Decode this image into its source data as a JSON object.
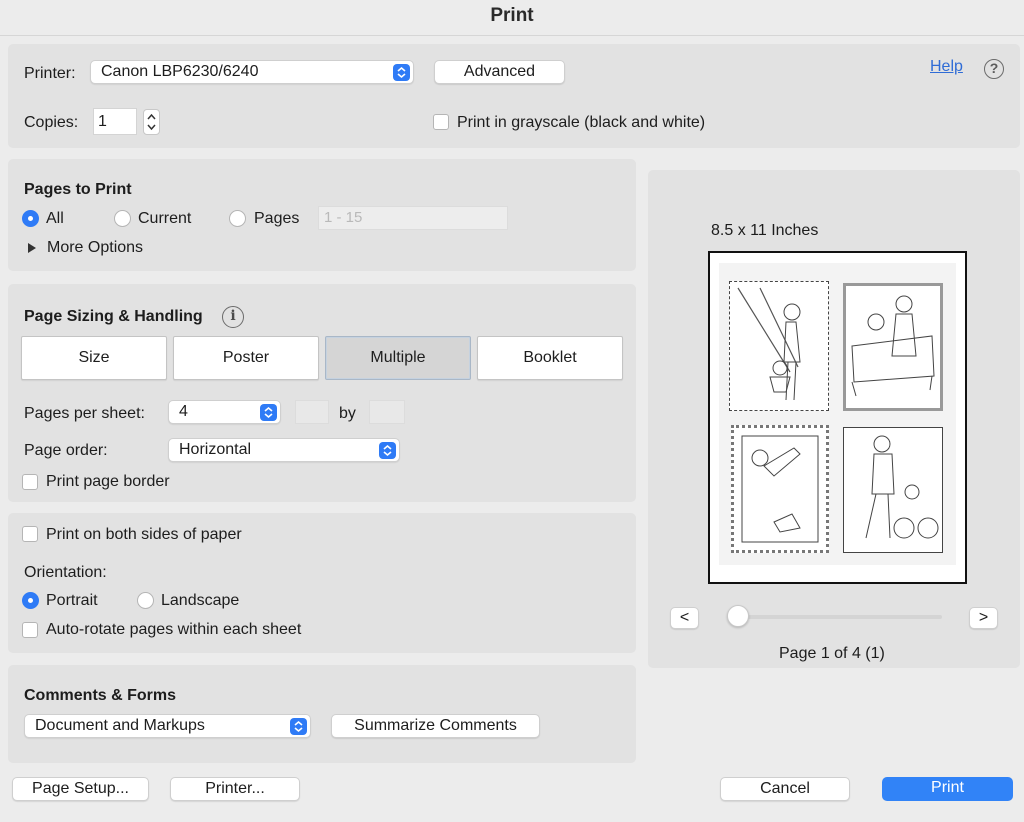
{
  "window": {
    "title": "Print"
  },
  "printer": {
    "label": "Printer:",
    "selected": "Canon LBP6230/6240",
    "advanced_label": "Advanced",
    "help_label": "Help",
    "copies_label": "Copies:",
    "copies_value": "1",
    "grayscale_label": "Print in grayscale (black and white)",
    "grayscale_checked": false
  },
  "pages_to_print": {
    "heading": "Pages to Print",
    "options": [
      {
        "label": "All",
        "selected": true
      },
      {
        "label": "Current",
        "selected": false
      },
      {
        "label": "Pages",
        "selected": false
      }
    ],
    "pages_placeholder": "1 - 15",
    "more_options_label": "More Options"
  },
  "sizing": {
    "heading": "Page Sizing & Handling",
    "tabs": [
      {
        "label": "Size",
        "selected": false
      },
      {
        "label": "Poster",
        "selected": false
      },
      {
        "label": "Multiple",
        "selected": true
      },
      {
        "label": "Booklet",
        "selected": false
      }
    ],
    "pages_per_sheet_label": "Pages per sheet:",
    "pages_per_sheet_value": "4",
    "by_label": "by",
    "page_order_label": "Page order:",
    "page_order_value": "Horizontal",
    "border_label": "Print page border"
  },
  "layout": {
    "duplex_label": "Print on both sides of paper",
    "orientation_label": "Orientation:",
    "portrait_label": "Portrait",
    "landscape_label": "Landscape",
    "portrait_selected": true,
    "autorotate_label": "Auto-rotate pages within each sheet"
  },
  "comments": {
    "heading": "Comments & Forms",
    "selected": "Document and Markups",
    "summarize_label": "Summarize Comments"
  },
  "preview": {
    "paper_size": "8.5 x 11 Inches",
    "prev_label": "<",
    "next_label": ">",
    "page_info": "Page 1 of 4 (1)",
    "slider_position": 0
  },
  "footer": {
    "page_setup_label": "Page Setup...",
    "printer_label": "Printer...",
    "cancel_label": "Cancel",
    "print_label": "Print"
  },
  "colors": {
    "accent": "#2f7bf6",
    "panel": "#e2e2e2",
    "background": "#ececec",
    "link": "#2f6cd6"
  }
}
